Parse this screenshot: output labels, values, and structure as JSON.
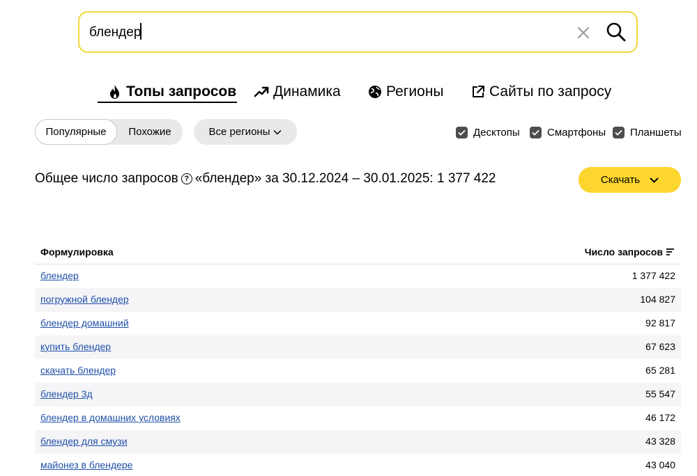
{
  "search": {
    "value": "блендер"
  },
  "tabs": [
    {
      "label": "Топы запросов",
      "icon": "fire-icon",
      "active": true
    },
    {
      "label": "Динамика",
      "icon": "trend-up-icon"
    },
    {
      "label": "Регионы",
      "icon": "globe-icon"
    },
    {
      "label": "Сайты по запросу",
      "icon": "external-link-icon"
    }
  ],
  "filters": {
    "popular_label": "Популярные",
    "similar_label": "Похожие",
    "regions_label": "Все регионы",
    "devices": [
      {
        "label": "Десктопы",
        "checked": true
      },
      {
        "label": "Смартфоны",
        "checked": true
      },
      {
        "label": "Планшеты",
        "checked": true
      }
    ]
  },
  "summary": {
    "prefix": "Общее число запросов",
    "rest": "«блендер» за 30.12.2024 – 30.01.2025: 1 377 422",
    "help_icon": "?"
  },
  "download_label": "Скачать",
  "table": {
    "col_phrase": "Формулировка",
    "col_count": "Число запросов",
    "rows": [
      {
        "phrase": "блендер",
        "count": "1 377 422"
      },
      {
        "phrase": "погружной блендер",
        "count": "104 827"
      },
      {
        "phrase": "блендер домашний",
        "count": "92 817"
      },
      {
        "phrase": "купить блендер",
        "count": "67 623"
      },
      {
        "phrase": "скачать блендер",
        "count": "65 281"
      },
      {
        "phrase": "блендер 3д",
        "count": "55 547"
      },
      {
        "phrase": "блендер в домашних условиях",
        "count": "46 172"
      },
      {
        "phrase": "блендер для смузи",
        "count": "43 328"
      },
      {
        "phrase": "майонез в блендере",
        "count": "43 040"
      }
    ]
  },
  "colors": {
    "accent": "#fcd62f",
    "search_border": "#f4d737",
    "link": "#1e4fa8"
  }
}
